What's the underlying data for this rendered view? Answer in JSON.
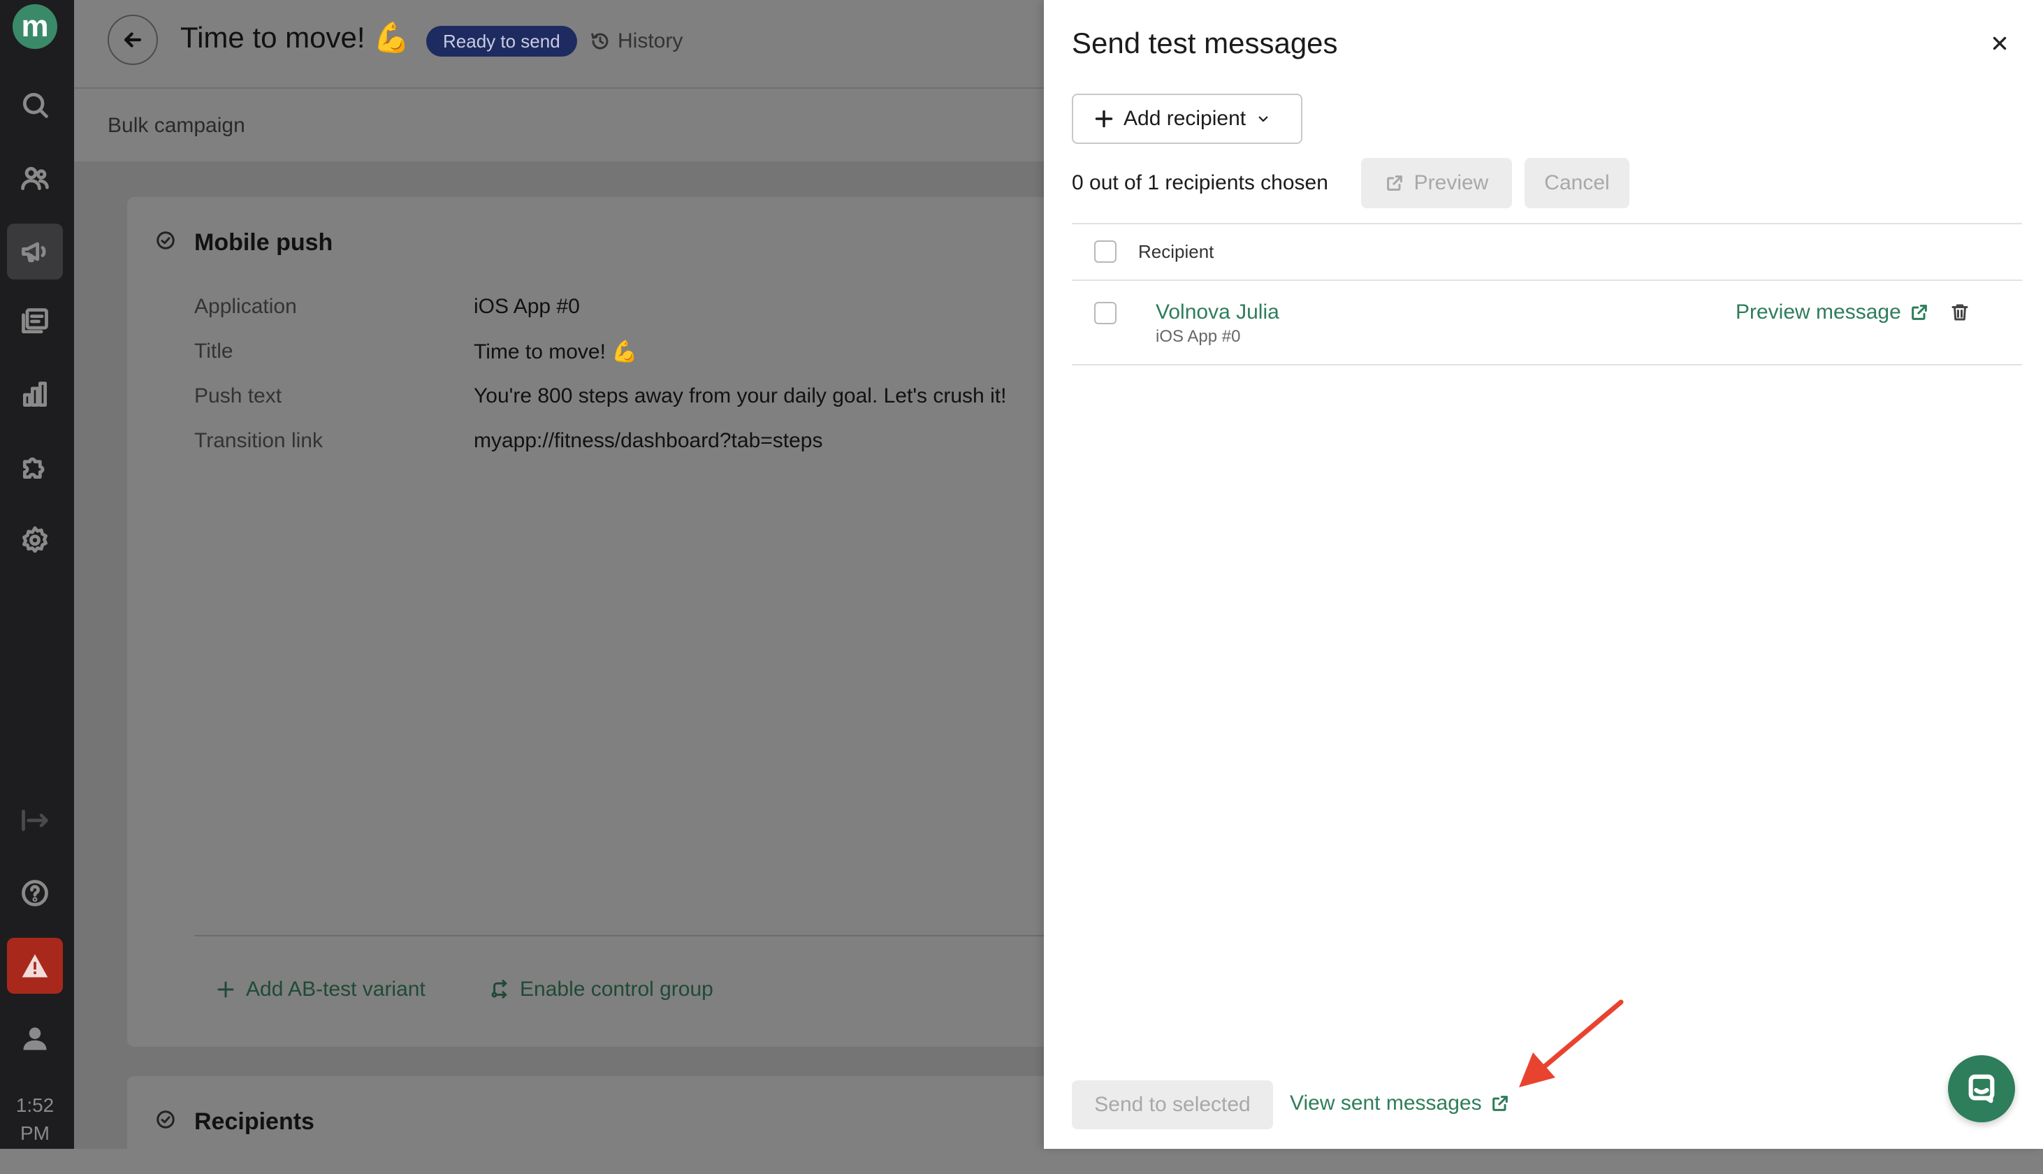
{
  "app": {
    "logo_letter": "m",
    "clock": "1:52 PM"
  },
  "sidebar": {
    "icons": [
      "search-icon",
      "users-icon",
      "megaphone-icon",
      "messages-icon",
      "bar-chart-icon",
      "puzzle-icon",
      "gear-icon",
      "logout-icon",
      "help-icon",
      "warning-icon",
      "user-icon"
    ],
    "active": "megaphone-icon"
  },
  "header": {
    "title": "Time to move! 💪",
    "status": "Ready to send",
    "history_label": "History",
    "subtitle": "Bulk campaign"
  },
  "mobile_push": {
    "title": "Mobile push",
    "fields": [
      {
        "label": "Application",
        "value": "iOS App #0"
      },
      {
        "label": "Title",
        "value": "Time to move! 💪"
      },
      {
        "label": "Push text",
        "value": "You're 800 steps away from your daily goal. Let's crush it!"
      },
      {
        "label": "Transition link",
        "value": "myapp://fitness/dashboard?tab=steps"
      }
    ],
    "add_ab_label": "Add AB-test variant",
    "control_group_label": "Enable control group"
  },
  "recipients_section": {
    "title": "Recipients"
  },
  "panel": {
    "title": "Send test messages",
    "add_recipient_label": "Add recipient",
    "chosen_text": "0 out of 1 recipients chosen",
    "preview_label": "Preview",
    "cancel_label": "Cancel",
    "column_header": "Recipient",
    "rows": [
      {
        "name": "Volnova Julia",
        "app": "iOS App #0",
        "preview_label": "Preview message"
      }
    ],
    "send_label": "Send to selected",
    "view_sent_label": "View sent messages"
  },
  "colors": {
    "accent": "#2e7d5b",
    "badge": "#1e2b60",
    "annotation_arrow": "#e8432f",
    "alert": "#a8291c"
  }
}
